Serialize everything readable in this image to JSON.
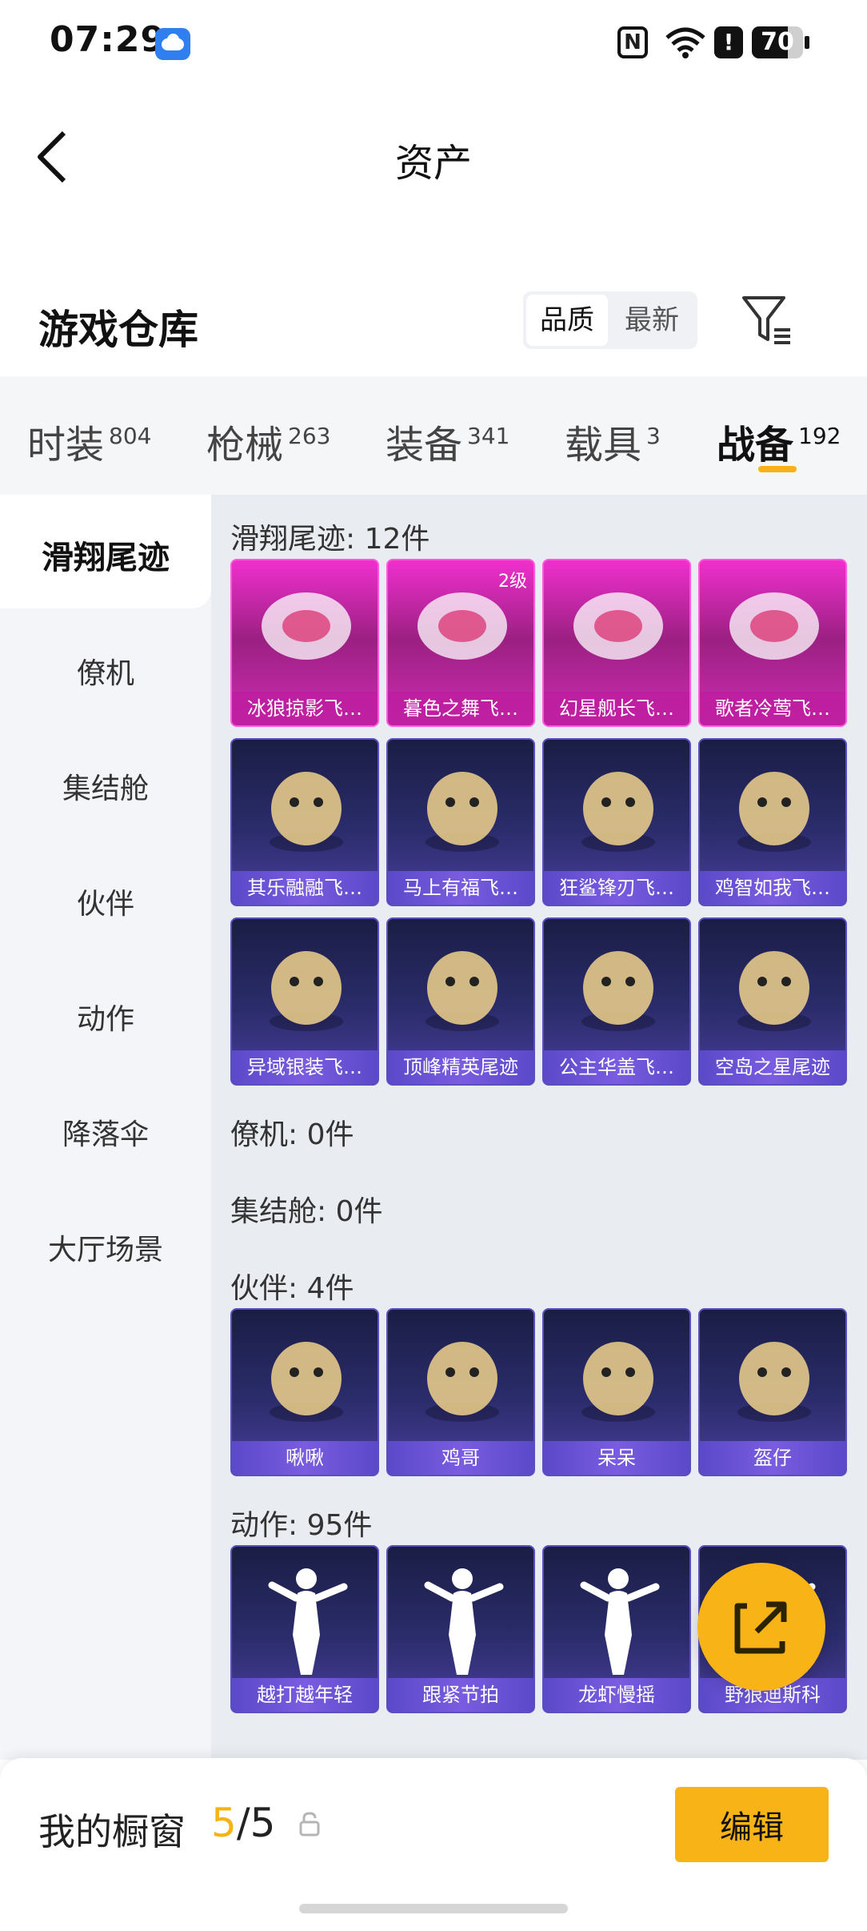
{
  "status_bar": {
    "time": "07:29",
    "battery": "70",
    "battery_level": 0.7,
    "alert": "!",
    "nfc": "N"
  },
  "nav": {
    "title": "资产"
  },
  "header": {
    "title": "游戏仓库",
    "sort_options": [
      "品质",
      "最新"
    ],
    "sort_selected": "品质"
  },
  "tabs": [
    {
      "label": "时装",
      "count": "804"
    },
    {
      "label": "枪械",
      "count": "263"
    },
    {
      "label": "装备",
      "count": "341"
    },
    {
      "label": "载具",
      "count": "3"
    },
    {
      "label": "战备",
      "count": "192",
      "active": true
    }
  ],
  "sidebar": {
    "items": [
      "滑翔尾迹",
      "僚机",
      "集结舱",
      "伙伴",
      "动作",
      "降落伞",
      "大厅场景"
    ],
    "active": "滑翔尾迹"
  },
  "groups": [
    {
      "title": "滑翔尾迹: 12件",
      "items": [
        {
          "name": "冰狼掠影飞…",
          "style": "pink",
          "icon": "ice-wing-icon"
        },
        {
          "name": "暮色之舞飞…",
          "style": "pink",
          "badge": "2级",
          "icon": "dusk-dance-icon"
        },
        {
          "name": "幻星舰长飞…",
          "style": "pink",
          "icon": "star-captain-icon"
        },
        {
          "name": "歌者冷莺飞…",
          "style": "pink",
          "icon": "singer-bird-icon"
        },
        {
          "name": "其乐融融飞…",
          "style": "blue",
          "icon": "penguin-icon"
        },
        {
          "name": "马上有福飞…",
          "style": "blue",
          "icon": "horse-icon"
        },
        {
          "name": "狂鲨锋刃飞…",
          "style": "blue",
          "icon": "shark-icon"
        },
        {
          "name": "鸡智如我飞…",
          "style": "blue",
          "icon": "chicken-icon"
        },
        {
          "name": "异域银装飞…",
          "style": "blue",
          "icon": "exotic-wing-icon"
        },
        {
          "name": "顶峰精英尾迹",
          "style": "blue",
          "icon": "flame-trail-icon"
        },
        {
          "name": "公主华盖飞…",
          "style": "blue",
          "icon": "canopy-icon"
        },
        {
          "name": "空岛之星尾迹",
          "style": "blue",
          "icon": "rainbow-trail-icon"
        }
      ]
    },
    {
      "title": "僚机: 0件",
      "items": []
    },
    {
      "title": "集结舱: 0件",
      "items": []
    },
    {
      "title": "伙伴: 4件",
      "items": [
        {
          "name": "啾啾",
          "style": "blue",
          "icon": "pink-bird-icon"
        },
        {
          "name": "鸡哥",
          "style": "blue",
          "icon": "chicken-sunglasses-icon"
        },
        {
          "name": "呆呆",
          "style": "blue",
          "icon": "egg-chick-icon"
        },
        {
          "name": "盔仔",
          "style": "blue",
          "icon": "helmet-chick-icon"
        }
      ]
    },
    {
      "title": "动作: 95件",
      "items": [
        {
          "name": "越打越年轻",
          "style": "blue",
          "icon": "dance-pose-icon"
        },
        {
          "name": "跟紧节拍",
          "style": "blue",
          "icon": "dance-pose-icon"
        },
        {
          "name": "龙虾慢摇",
          "style": "blue",
          "icon": "dance-pose-icon"
        },
        {
          "name": "野狼迪斯科",
          "style": "blue",
          "icon": "dance-pose-icon"
        }
      ]
    }
  ],
  "bottom_bar": {
    "label": "我的橱窗",
    "showcase_current": "5",
    "showcase_sep": "/",
    "showcase_total": "5",
    "edit_label": "编辑"
  },
  "colors": {
    "accent": "#f8b417",
    "pink_card": "#e02fc0",
    "blue_card": "#2b2c6c"
  }
}
